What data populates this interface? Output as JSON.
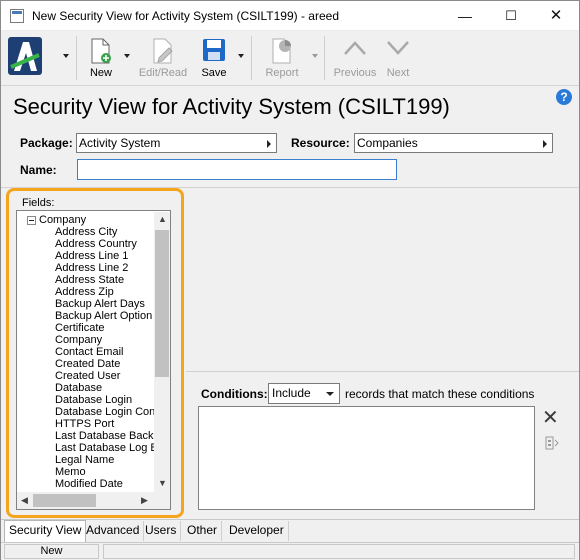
{
  "window": {
    "title": "New Security View for Activity System (CSILT199) - areed"
  },
  "toolbar": {
    "new_label": "New",
    "editread_label": "Edit/Read",
    "save_label": "Save",
    "report_label": "Report",
    "previous_label": "Previous",
    "next_label": "Next"
  },
  "header": {
    "title": "Security View for Activity System (CSILT199)"
  },
  "form": {
    "package_label": "Package:",
    "package_value": "Activity System",
    "resource_label": "Resource:",
    "resource_value": "Companies",
    "name_label": "Name:",
    "name_value": ""
  },
  "fields": {
    "label": "Fields:",
    "root": "Company",
    "items": [
      "Address City",
      "Address Country",
      "Address Line 1",
      "Address Line 2",
      "Address State",
      "Address Zip",
      "Backup Alert Days",
      "Backup Alert Option",
      "Certificate",
      "Company",
      "Contact Email",
      "Created Date",
      "Created User",
      "Database",
      "Database Login",
      "Database Login Con",
      "HTTPS Port",
      "Last Database Backu",
      "Last Database Log B",
      "Legal Name",
      "Memo",
      "Modified Date"
    ]
  },
  "conditions": {
    "label": "Conditions:",
    "mode": "Include",
    "suffix_text": "records that match these conditions"
  },
  "tabs": [
    "Security View",
    "Advanced",
    "Users",
    "Other",
    "Developer"
  ],
  "status": {
    "mode": "New"
  },
  "colors": {
    "highlight": "#f4a51c",
    "accent": "#2a7ad8"
  }
}
